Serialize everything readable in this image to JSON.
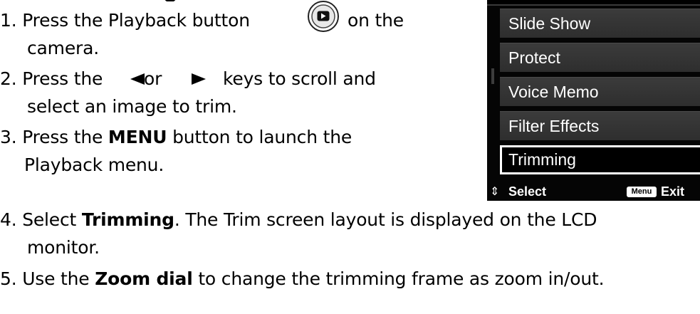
{
  "steps": {
    "s1_a": "1. Press the Playback button",
    "s1_b": "on the",
    "s1_c": "camera.",
    "s2_a": "2. Press the",
    "s2_or": "or",
    "s2_b": "keys to scroll and",
    "s2_c": "select an image to trim.",
    "s3_a": "3. Press the",
    "s3_bold": "MENU",
    "s3_b": "button to launch the",
    "s3_c": "Playback menu.",
    "s4_a": "4. Select",
    "s4_bold": "Trimming",
    "s4_b": ". The Trim screen layout is displayed on the LCD",
    "s4_c": "monitor.",
    "s5_a": "5. Use the",
    "s5_bold": "Zoom dial",
    "s5_b": "to change the trimming frame as zoom in/out."
  },
  "lcd_menu": {
    "items": [
      "Slide Show",
      "Protect",
      "Voice Memo",
      "Filter Effects",
      "Trimming"
    ],
    "selected_index": 4,
    "footer_select": "Select",
    "footer_menu_key": "Menu",
    "footer_exit": "Exit"
  },
  "icons": {
    "playback": "playback-button-icon",
    "left_arrow": "left-arrow-key-icon",
    "right_arrow": "right-arrow-key-icon",
    "updown": "up-down-arrows-icon"
  }
}
